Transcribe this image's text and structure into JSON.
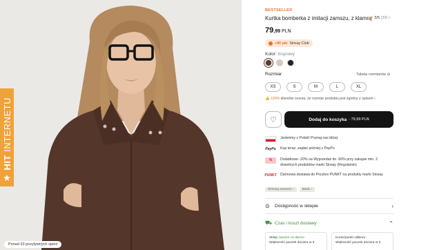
{
  "gallery": {
    "hit_badge": {
      "bold": "HIT",
      "thin": "INTERNETU",
      "icon": "star-icon"
    },
    "reviews_pill": "Ponad 33 pozytywnych opinii"
  },
  "product": {
    "badge": "BESTSELLER",
    "title": "Kurtka bomberka z imitacji zamszu, z klamrą",
    "rating": {
      "star": "★",
      "value": "5/5",
      "count": "(33)",
      "chevron": "›"
    },
    "price": {
      "main": "79",
      "cents": ",99",
      "currency": "PLN"
    },
    "club": {
      "points": "+80 pkt",
      "label": "Sinsay Club"
    },
    "color": {
      "label": "Kolor:",
      "value": "brązowy"
    },
    "swatches": [
      "#5a3a2c",
      "#d8cbb4",
      "#1d2433"
    ],
    "size": {
      "label": "Rozmiar",
      "table_link": "Tabela rozmiarów ⊖",
      "options": [
        "XS",
        "S",
        "M",
        "L",
        "XL"
      ]
    },
    "fit_note": {
      "percent": "100%",
      "text": "klientów ocenia, że rozmiar produktu jest zgodny z opisem ›"
    },
    "favorite_icon": "heart-icon",
    "cart": {
      "label": "Dodaj do koszyka",
      "price": "- 79,99 PLN"
    }
  },
  "benefits": [
    {
      "icon": "poland-flag-icon",
      "text": "Jesteśmy z Polski! Poznaj nas bliżej"
    },
    {
      "icon": "paypo-icon",
      "icon_text": "PayPo",
      "text": "Kup teraz, zapłać później z PayPo"
    },
    {
      "icon": "sale-icon",
      "icon_text": "%",
      "text": "Dodatkowe -20% na Wyprzedaż do -50% przy zakupie min. 2 dowolnych produktów marki Sinsay (Regulamin)"
    },
    {
      "icon": "punkt-icon",
      "icon_text": "PUNKT",
      "text": "Darmowa dostawa do Pocztex PUNKT na produkty marki Sinsay"
    }
  ],
  "tags": [
    "Shining summer ›",
    "Basic ›"
  ],
  "store_availability": {
    "icon": "location-icon",
    "label": "Dostępność w sklepie",
    "chevron": "›"
  },
  "delivery": {
    "icon": "truck-icon",
    "label": "Czas i koszt dostawy",
    "chevron": "⌃"
  },
  "delivery_options": [
    {
      "title": "Sklep",
      "highlight": "zawsze za darmo",
      "desc": "Większość paczek dociera w 3"
    },
    {
      "title": "Kurier/punkt odbioru",
      "highlight": "",
      "desc": "Większość paczek dociera w 3"
    }
  ],
  "colors": {
    "accent": "#e8742a",
    "button": "#141414",
    "green": "#3f8a3a",
    "hit_badge": "#f0a23a"
  }
}
